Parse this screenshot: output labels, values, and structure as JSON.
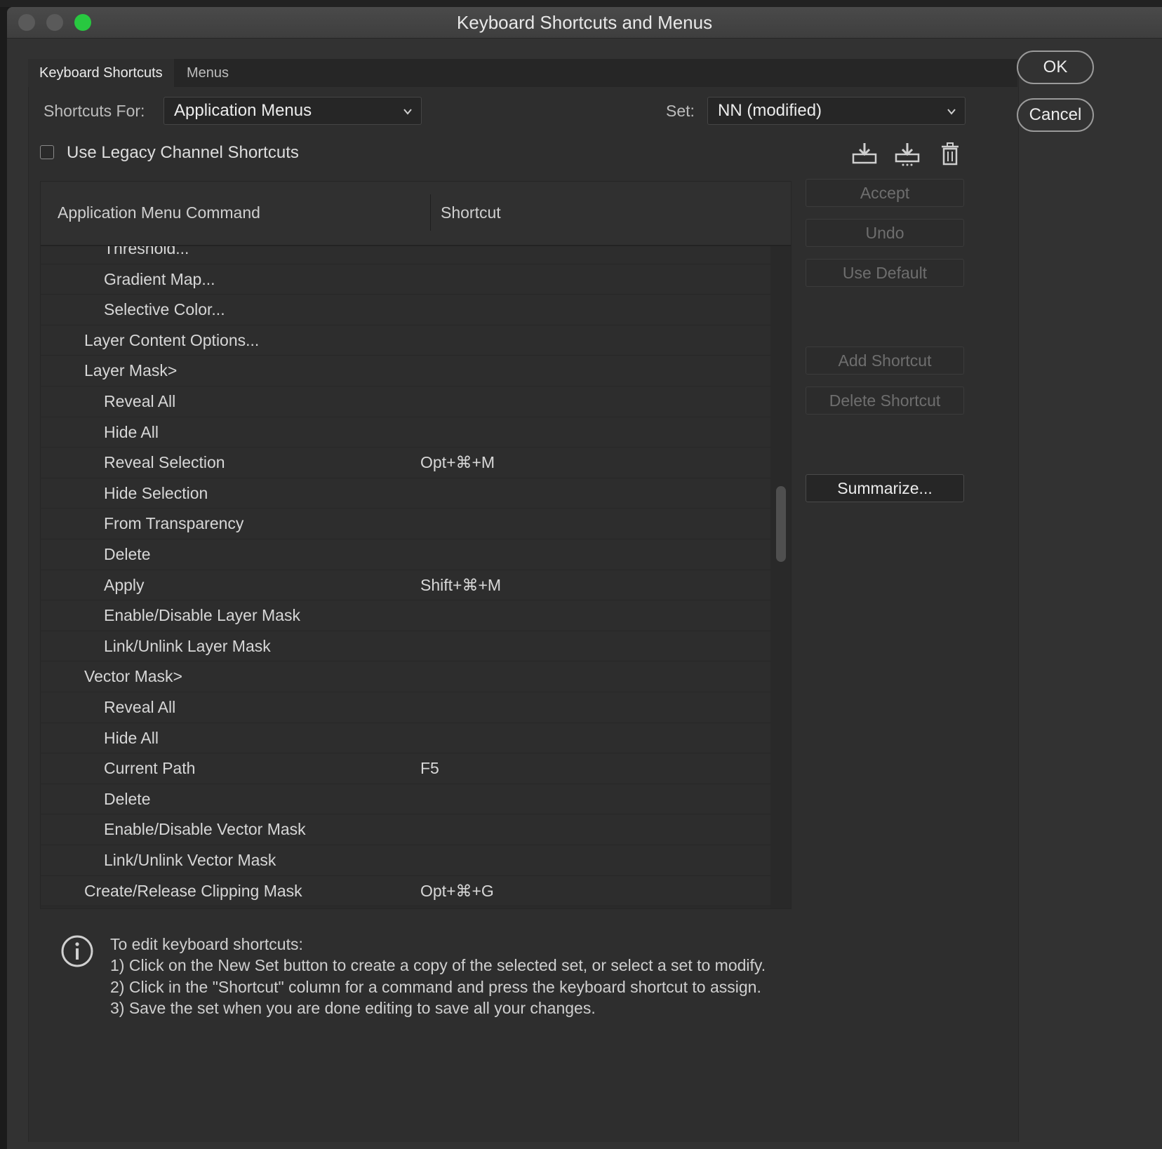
{
  "window": {
    "title": "Keyboard Shortcuts and Menus"
  },
  "tabs": [
    {
      "label": "Keyboard Shortcuts"
    },
    {
      "label": "Menus"
    }
  ],
  "controls": {
    "shortcuts_for_label": "Shortcuts For:",
    "shortcuts_for_value": "Application Menus",
    "set_label": "Set:",
    "set_value": "NN (modified)",
    "legacy_checkbox_label": "Use Legacy Channel Shortcuts",
    "legacy_checked": false
  },
  "icons": {
    "save_set": "save-set-icon",
    "new_set": "new-set-icon",
    "delete_set": "trash-icon",
    "info": "info-icon"
  },
  "table": {
    "columns": [
      "Application Menu Command",
      "Shortcut"
    ],
    "rows": [
      {
        "indent": 2,
        "command": "Threshold...",
        "shortcut": ""
      },
      {
        "indent": 2,
        "command": "Gradient Map...",
        "shortcut": ""
      },
      {
        "indent": 2,
        "command": "Selective Color...",
        "shortcut": ""
      },
      {
        "indent": 1,
        "command": "Layer Content Options...",
        "shortcut": ""
      },
      {
        "indent": 1,
        "command": "Layer Mask>",
        "shortcut": ""
      },
      {
        "indent": 2,
        "command": "Reveal All",
        "shortcut": ""
      },
      {
        "indent": 2,
        "command": "Hide All",
        "shortcut": ""
      },
      {
        "indent": 2,
        "command": "Reveal Selection",
        "shortcut": "Opt+⌘+M"
      },
      {
        "indent": 2,
        "command": "Hide Selection",
        "shortcut": ""
      },
      {
        "indent": 2,
        "command": "From Transparency",
        "shortcut": ""
      },
      {
        "indent": 2,
        "command": "Delete",
        "shortcut": ""
      },
      {
        "indent": 2,
        "command": "Apply",
        "shortcut": "Shift+⌘+M"
      },
      {
        "indent": 2,
        "command": "Enable/Disable Layer Mask",
        "shortcut": ""
      },
      {
        "indent": 2,
        "command": "Link/Unlink Layer Mask",
        "shortcut": ""
      },
      {
        "indent": 1,
        "command": "Vector Mask>",
        "shortcut": ""
      },
      {
        "indent": 2,
        "command": "Reveal All",
        "shortcut": ""
      },
      {
        "indent": 2,
        "command": "Hide All",
        "shortcut": ""
      },
      {
        "indent": 2,
        "command": "Current Path",
        "shortcut": "F5"
      },
      {
        "indent": 2,
        "command": "Delete",
        "shortcut": ""
      },
      {
        "indent": 2,
        "command": "Enable/Disable Vector Mask",
        "shortcut": ""
      },
      {
        "indent": 2,
        "command": "Link/Unlink Vector Mask",
        "shortcut": ""
      },
      {
        "indent": 1,
        "command": "Create/Release Clipping Mask",
        "shortcut": "Opt+⌘+G"
      }
    ]
  },
  "side_buttons": {
    "accept": "Accept",
    "undo": "Undo",
    "use_default": "Use Default",
    "add_shortcut": "Add Shortcut",
    "delete_shortcut": "Delete Shortcut",
    "summarize": "Summarize..."
  },
  "dialog_buttons": {
    "ok": "OK",
    "cancel": "Cancel"
  },
  "info": {
    "heading": "To edit keyboard shortcuts:",
    "steps": [
      "1) Click on the New Set button to create a copy of the selected set, or select a set to modify.",
      "2) Click in the \"Shortcut\" column for a command and press the keyboard shortcut to assign.",
      "3) Save the set when you are done editing to save all your changes."
    ]
  }
}
